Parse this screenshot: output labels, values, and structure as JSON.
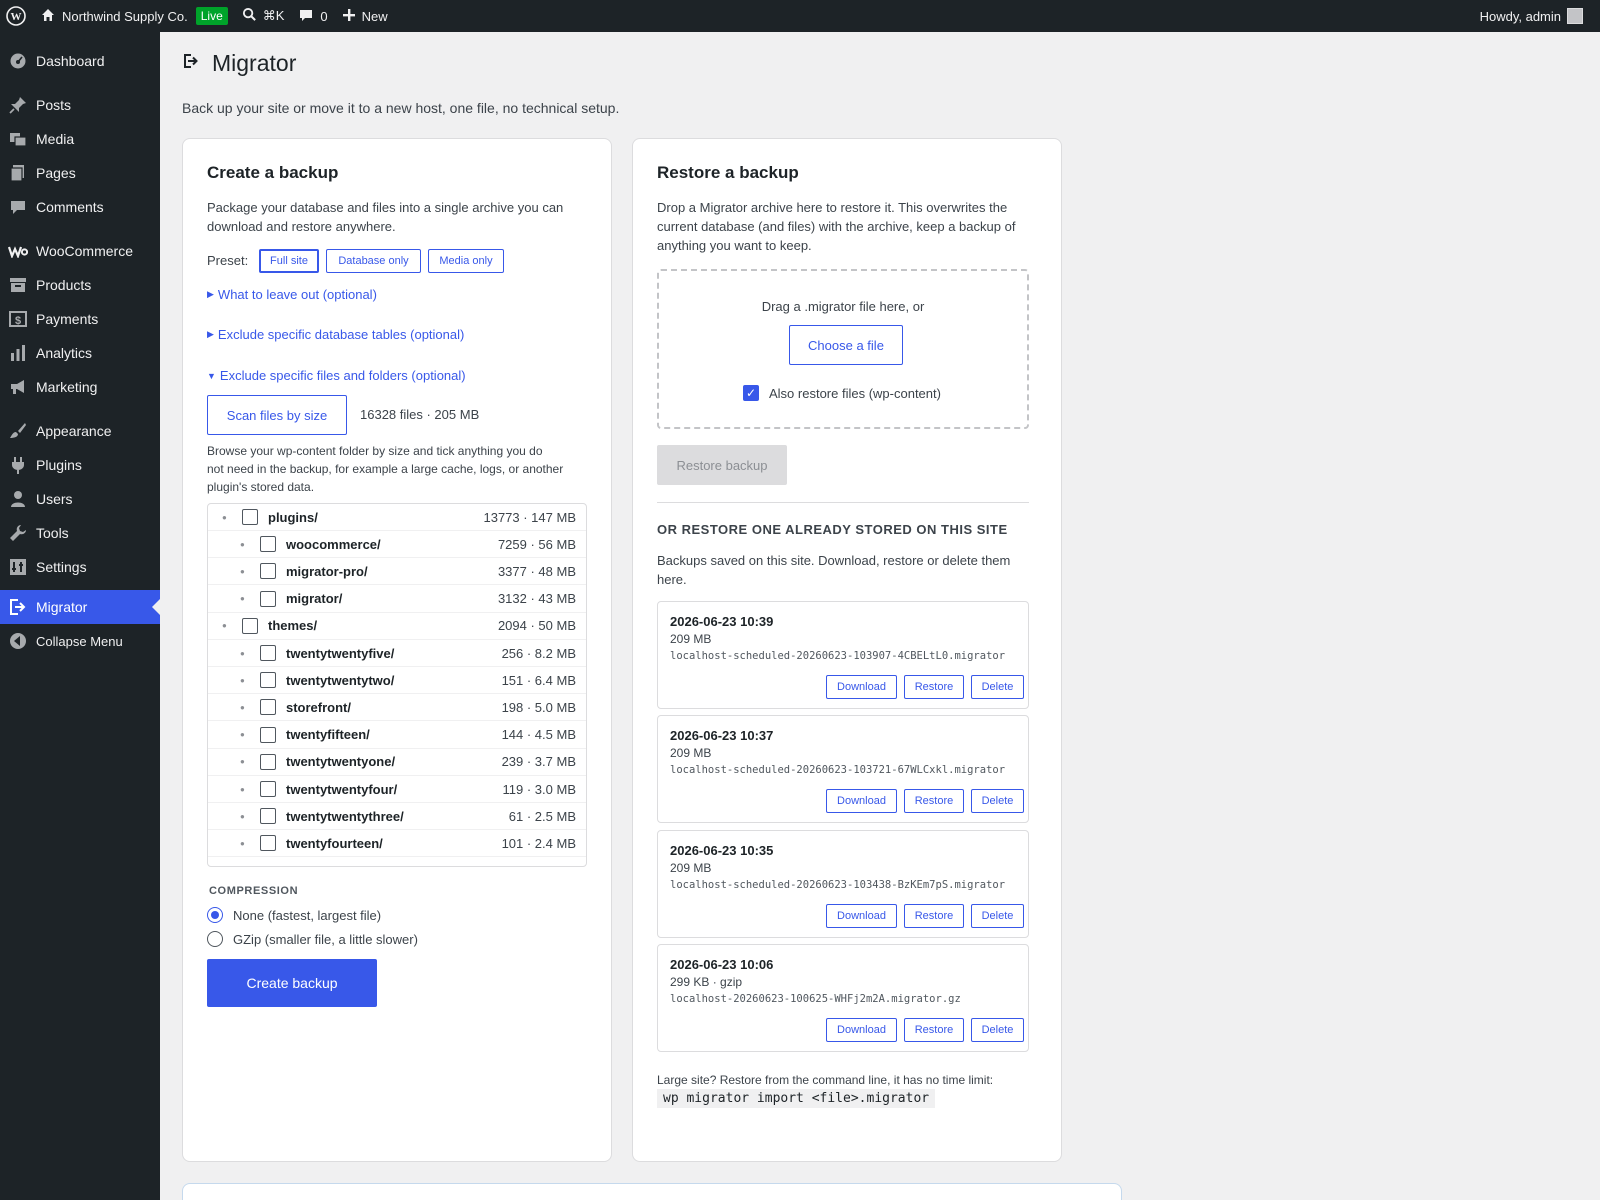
{
  "admin_bar": {
    "site_name": "Northwind Supply Co.",
    "live_label": "Live",
    "search_shortcut": "⌘K",
    "comments_count": "0",
    "new_label": "New",
    "howdy": "Howdy, admin"
  },
  "sidebar": {
    "items": [
      {
        "label": "Dashboard",
        "icon": "dashboard-icon"
      },
      {
        "label": "Posts",
        "icon": "pin-icon"
      },
      {
        "label": "Media",
        "icon": "media-icon"
      },
      {
        "label": "Pages",
        "icon": "pages-icon"
      },
      {
        "label": "Comments",
        "icon": "comment-icon"
      },
      {
        "label": "WooCommerce",
        "icon": "woo-icon"
      },
      {
        "label": "Products",
        "icon": "archive-icon"
      },
      {
        "label": "Payments",
        "icon": "dollar-icon"
      },
      {
        "label": "Analytics",
        "icon": "chart-bar-icon"
      },
      {
        "label": "Marketing",
        "icon": "megaphone-icon"
      },
      {
        "label": "Appearance",
        "icon": "paintbrush-icon"
      },
      {
        "label": "Plugins",
        "icon": "plugin-icon"
      },
      {
        "label": "Users",
        "icon": "user-icon"
      },
      {
        "label": "Tools",
        "icon": "wrench-icon"
      },
      {
        "label": "Settings",
        "icon": "settings-icon"
      },
      {
        "label": "Migrator",
        "icon": "migrate-icon"
      },
      {
        "label": "Collapse Menu",
        "icon": "collapse-icon"
      }
    ]
  },
  "page": {
    "title": "Migrator",
    "intro": "Back up your site or move it to a new host, one file, no technical setup."
  },
  "create": {
    "title": "Create a backup",
    "desc_line1": "Package your database and files into a single archive you can",
    "desc_line2": "download and restore anywhere.",
    "preset_label": "Preset:",
    "presets": [
      "Full site",
      "Database only",
      "Media only"
    ],
    "toggle_leave_out": "What to leave out (optional)",
    "toggle_db_tables": "Exclude specific database tables (optional)",
    "toggle_files": "Exclude specific files and folders (optional)",
    "scan_button": "Scan files by size",
    "scan_summary": "16328 files · 205 MB",
    "browse_line1": "Browse your wp-content folder by size and tick anything you do",
    "browse_line2": "not need in the backup, for example a large cache, logs, or another",
    "browse_line3": "plugin's stored data.",
    "tree": [
      {
        "name": "plugins/",
        "size": "13773 · 147 MB",
        "level": 0
      },
      {
        "name": "woocommerce/",
        "size": "7259 · 56 MB",
        "level": 1
      },
      {
        "name": "migrator-pro/",
        "size": "3377 · 48 MB",
        "level": 1
      },
      {
        "name": "migrator/",
        "size": "3132 · 43 MB",
        "level": 1
      },
      {
        "name": "themes/",
        "size": "2094 · 50 MB",
        "level": 0
      },
      {
        "name": "twentytwentyfive/",
        "size": "256 · 8.2 MB",
        "level": 1
      },
      {
        "name": "twentytwentytwo/",
        "size": "151 · 6.4 MB",
        "level": 1
      },
      {
        "name": "storefront/",
        "size": "198 · 5.0 MB",
        "level": 1
      },
      {
        "name": "twentyfifteen/",
        "size": "144 · 4.5 MB",
        "level": 1
      },
      {
        "name": "twentytwentyone/",
        "size": "239 · 3.7 MB",
        "level": 1
      },
      {
        "name": "twentytwentyfour/",
        "size": "119 · 3.0 MB",
        "level": 1
      },
      {
        "name": "twentytwentythree/",
        "size": "61 · 2.5 MB",
        "level": 1
      },
      {
        "name": "twentyfourteen/",
        "size": "101 · 2.4 MB",
        "level": 1
      }
    ],
    "compression_label": "COMPRESSION",
    "compression_none": "None (fastest, largest file)",
    "compression_gzip": "GZip (smaller file, a little slower)",
    "create_button": "Create backup"
  },
  "restore": {
    "title": "Restore a backup",
    "desc_line1": "Drop a Migrator archive here to restore it. This overwrites the",
    "desc_line2": "current database (and files) with the archive, keep a backup of",
    "desc_line3": "anything you want to keep.",
    "drag_text": "Drag a .migrator file here, or",
    "choose_button": "Choose a file",
    "also_restore": "Also restore files (wp-content)",
    "restore_button": "Restore backup",
    "stored_heading": "OR RESTORE ONE ALREADY STORED ON THIS SITE",
    "stored_desc_line1": "Backups saved on this site. Download, restore or delete them",
    "stored_desc_line2": "here.",
    "backups": [
      {
        "date": "2026-06-23 10:39",
        "size": "209 MB",
        "file": "localhost-scheduled-20260623-103907-4CBELtL0.migrator"
      },
      {
        "date": "2026-06-23 10:37",
        "size": "209 MB",
        "file": "localhost-scheduled-20260623-103721-67WLCxkl.migrator"
      },
      {
        "date": "2026-06-23 10:35",
        "size": "209 MB",
        "file": "localhost-scheduled-20260623-103438-BzKEm7pS.migrator"
      },
      {
        "date": "2026-06-23 10:06",
        "size": "299 KB · gzip",
        "file": "localhost-20260623-100625-WHFj2m2A.migrator.gz"
      }
    ],
    "download_label": "Download",
    "restore_label": "Restore",
    "delete_label": "Delete",
    "cli_note": "Large site? Restore from the command line, it has no time limit:",
    "cli_command": "wp migrator import <file>.migrator"
  },
  "colors": {
    "accent": "#3858e9",
    "admin_bar": "#1d2327",
    "live_badge": "#00a32a"
  }
}
